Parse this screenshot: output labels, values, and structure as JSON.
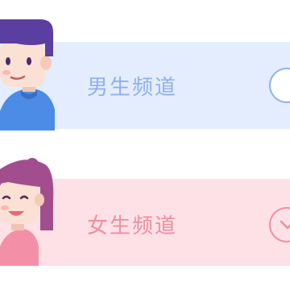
{
  "channels": {
    "male": {
      "label": "男生频道",
      "selected": false,
      "accent": "#8fb0ec",
      "background": "#e3edfd",
      "avatar_icon": "boy-avatar-icon"
    },
    "female": {
      "label": "女生频道",
      "selected": true,
      "accent": "#f08e9f",
      "background": "#fde1e6",
      "avatar_icon": "girl-avatar-icon"
    }
  }
}
